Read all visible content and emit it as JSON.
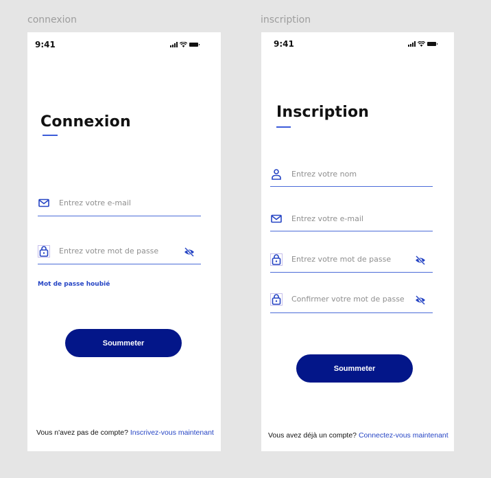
{
  "login": {
    "frame_label": "connexion",
    "status_time": "9:41",
    "title": "Connexion",
    "email_placeholder": "Entrez votre e-mail",
    "password_placeholder": "Entrez votre mot de passe",
    "forgot_label": "Mot de passe houbié",
    "submit_label": "Soummeter",
    "footer_text": "Vous n'avez pas de compte?",
    "footer_link": "Inscrivez-vous maintenant"
  },
  "signup": {
    "frame_label": "inscription",
    "status_time": "9:41",
    "title": "Inscription",
    "name_placeholder": "Entrez votre nom",
    "email_placeholder": "Entrez votre e-mail",
    "password_placeholder": "Entrez votre mot de passe",
    "confirm_placeholder": "Confirmer votre mot de passe",
    "submit_label": "Soummeter",
    "footer_text": "Vous avez déjà un compte?",
    "footer_link": "Connectez-vous maintenant"
  },
  "colors": {
    "background": "#e5e5e5",
    "screen": "#ffffff",
    "primary_button": "#031689",
    "accent": "#3b5bd9",
    "link": "#2544c4"
  },
  "icons": [
    "signal-icon",
    "wifi-icon",
    "battery-icon",
    "mail-icon",
    "lock-icon",
    "eye-off-icon",
    "user-icon"
  ]
}
